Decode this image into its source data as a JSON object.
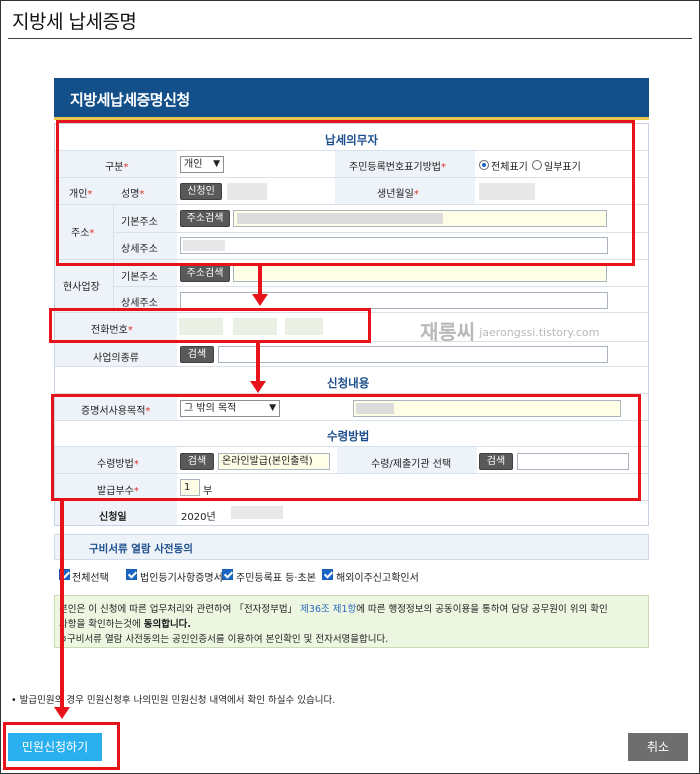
{
  "page": {
    "title": "지방세 납세증명"
  },
  "form": {
    "title": "지방세납세증명신청",
    "section_taxpayer": "납세의무자",
    "section_apply": "신청내용",
    "section_receive": "수령방법",
    "type_label": "구분",
    "type_value": "개인",
    "rrn_label": "주민등록번호표기방법",
    "rrn_full": "전체표기",
    "rrn_partial": "일부표기",
    "personal_label": "개인",
    "name_label": "성명",
    "applicant_button": "신청인",
    "birth_label": "생년월일",
    "address_label": "주소",
    "base_address_label": "기본주소",
    "address_search_button": "주소검색",
    "detail_address_label": "상세주소",
    "business_label": "현사업장",
    "biz_base_address_label": "기본주소",
    "biz_search_button": "주소검색",
    "biz_detail_address_label": "상세주소",
    "phone_label": "전화번호",
    "biz_type_label": "사업의종류",
    "biz_type_search": "검색",
    "purpose_label": "증명서사용목적",
    "purpose_value": "그 밖의 목적",
    "receive_label": "수령방법",
    "receive_search": "검색",
    "receive_value": "온라인발급(본인출력)",
    "agency_label": "수령/제출기관 선택",
    "agency_search": "검색",
    "copies_label": "발급부수",
    "copies_value": "1",
    "copies_unit": "부",
    "date_label": "신청일",
    "date_value": "2020년"
  },
  "consent": {
    "title": "구비서류 열람 사전동의",
    "select_all": "전체선택",
    "items": [
      "법인등기사항증명서",
      "주민등록표 등·초본",
      "해외이주신고확인서"
    ],
    "notice_1a": "본인은 이 신청에 따른 업무처리와 관련하여 「전자정부법」",
    "notice_1b": "제36조 제1항",
    "notice_1c": "에 따른 행정정보의 공동이용을 통하여 담당 공무원이 위의 확인",
    "notice_2a": "사항을 확인하는것에",
    "notice_2b": "동의합니다.",
    "notice_3": "※구비서류 열람 사전동의는 공인인증서를 이용하여 본인확인 및 전자서명을합니다."
  },
  "footer": {
    "note": "• 발급민원의 경우 민원신청후 나의민원 민원신청 내역에서 확인 하실수 있습니다.",
    "submit": "민원신청하기",
    "cancel": "취소"
  },
  "watermark": {
    "korean": "재롱씨",
    "url": "jaerongssi.tistory.com"
  },
  "colors": {
    "header": "#13508a",
    "accent": "#e9c64c",
    "annotation": "#e8121b",
    "submit": "#2bb0ef"
  }
}
